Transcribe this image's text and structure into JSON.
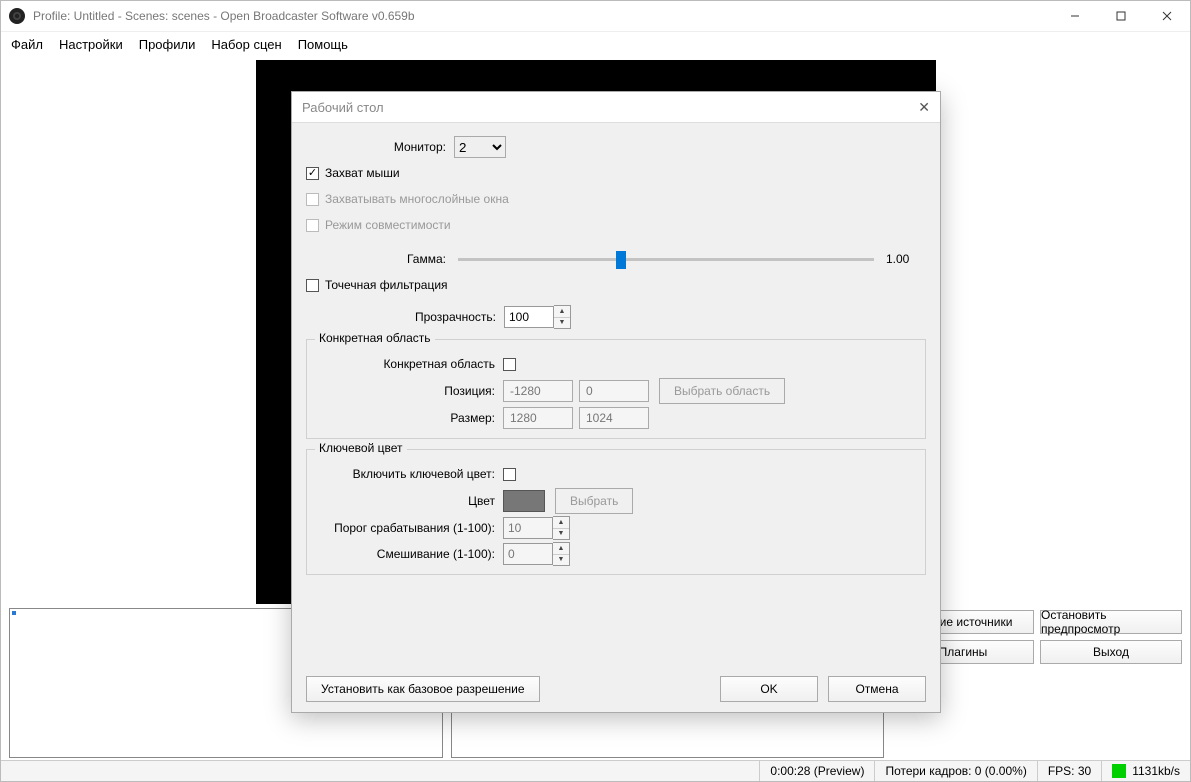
{
  "titlebar": {
    "title": "Profile: Untitled - Scenes: scenes - Open Broadcaster Software v0.659b"
  },
  "menubar": {
    "file": "Файл",
    "settings": "Настройки",
    "profiles": "Профили",
    "scenesets": "Набор сцен",
    "help": "Помощь"
  },
  "buttons": {
    "global_sources": "Общие источники",
    "stop_preview": "Остановить предпросмотр",
    "plugins": "Плагины",
    "exit": "Выход"
  },
  "status": {
    "time": "0:00:28 (Preview)",
    "dropped": "Потери кадров: 0 (0.00%)",
    "fps": "FPS: 30",
    "bitrate": "1131kb/s"
  },
  "dialog": {
    "title": "Рабочий стол",
    "monitor_label": "Монитор:",
    "monitor_value": "2",
    "capture_mouse": "Захват мыши",
    "capture_layered": "Захватывать многослойные окна",
    "compat_mode": "Режим совместимости",
    "gamma_label": "Гамма:",
    "gamma_value": "1.00",
    "point_filter": "Точечная фильтрация",
    "opacity_label": "Прозрачность:",
    "opacity_value": "100",
    "region_group": "Конкретная область",
    "region_enable": "Конкретная область",
    "position_label": "Позиция:",
    "pos_x": "-1280",
    "pos_y": "0",
    "select_region": "Выбрать область",
    "size_label": "Размер:",
    "size_w": "1280",
    "size_h": "1024",
    "chroma_group": "Ключевой цвет",
    "chroma_enable": "Включить ключевой цвет:",
    "color_label": "Цвет",
    "choose": "Выбрать",
    "thresh_label": "Порог срабатывания (1-100):",
    "thresh_value": "10",
    "blend_label": "Смешивание (1-100):",
    "blend_value": "0",
    "set_base": "Установить как базовое разрешение",
    "ok": "OK",
    "cancel": "Отмена"
  }
}
